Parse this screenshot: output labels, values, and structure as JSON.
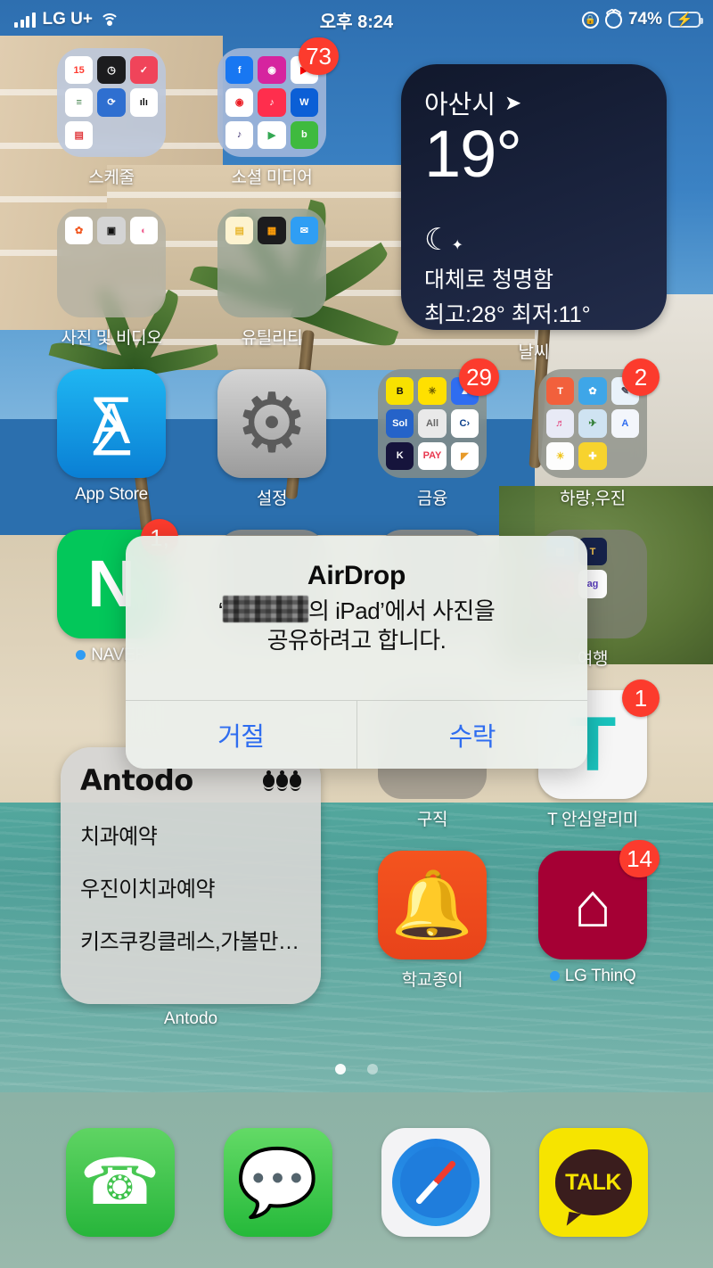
{
  "status_bar": {
    "carrier": "LG U+",
    "time": "오후 8:24",
    "battery_percent": "74%",
    "icons": [
      "signal-bars-icon",
      "wifi-icon",
      "rotation-lock-icon",
      "alarm-icon",
      "battery-charging-icon"
    ]
  },
  "weather_widget": {
    "city": "아산시",
    "temperature": "19°",
    "condition": "대체로 청명함",
    "high_low": "최고:28° 최저:11°",
    "label": "날씨",
    "location_icon": "location-arrow-icon",
    "condition_icon": "moon-stars-icon"
  },
  "antodo_widget": {
    "title": "Antodo",
    "items": [
      "치과예약",
      "우진이치과예약",
      "키즈쿠킹클레스,가볼만…"
    ],
    "label": "Antodo",
    "icon": "ants-icon"
  },
  "apps": [
    {
      "label": "스케줄",
      "type": "folder",
      "badge": "",
      "new": false,
      "folder_bg": "#b9c8e2",
      "minis": [
        {
          "name": "calendar-app",
          "bg": "#ffffff",
          "fg": "#ff3b30",
          "text": "15"
        },
        {
          "name": "clock-app",
          "bg": "#1c1c1e",
          "fg": "#ffffff",
          "text": "◷"
        },
        {
          "name": "todo-app",
          "bg": "#f0445a",
          "fg": "#ffffff",
          "text": "✓"
        },
        {
          "name": "planner-app",
          "bg": "#ffffff",
          "fg": "#3a7d44",
          "text": "≡"
        },
        {
          "name": "sync-app",
          "bg": "#2f6fd0",
          "fg": "#ffffff",
          "text": "⟳"
        },
        {
          "name": "habit-app",
          "bg": "#ffffff",
          "fg": "#111111",
          "text": "ılı"
        },
        {
          "name": "schedule-app",
          "bg": "#ffffff",
          "fg": "#e0383c",
          "text": "▤"
        },
        {
          "name": "empty-slot",
          "bg": "transparent",
          "fg": "",
          "text": ""
        },
        {
          "name": "empty-slot",
          "bg": "transparent",
          "fg": "",
          "text": ""
        }
      ]
    },
    {
      "label": "소셜 미디어",
      "type": "folder",
      "badge": "73",
      "new": false,
      "folder_bg": "#aebede",
      "minis": [
        {
          "name": "facebook-app",
          "bg": "#1877f2",
          "fg": "#ffffff",
          "text": "f"
        },
        {
          "name": "instagram-app",
          "bg": "#d6249f",
          "fg": "#ffffff",
          "text": "◉"
        },
        {
          "name": "youtube-app",
          "bg": "#ffffff",
          "fg": "#ff0000",
          "text": "▶"
        },
        {
          "name": "afreeca-app",
          "bg": "#ffffff",
          "fg": "#eb1c24",
          "text": "◉"
        },
        {
          "name": "tiktok-app",
          "bg": "#ff2e4d",
          "fg": "#ffffff",
          "text": "♪"
        },
        {
          "name": "wadiz-app",
          "bg": "#0b5fd6",
          "fg": "#ffffff",
          "text": "W"
        },
        {
          "name": "band-app",
          "bg": "#ffffff",
          "fg": "#3a2c6e",
          "text": "♪"
        },
        {
          "name": "playstore-app",
          "bg": "#ffffff",
          "fg": "#34a853",
          "text": "▶"
        },
        {
          "name": "blog-app",
          "bg": "#3fba3f",
          "fg": "#ffffff",
          "text": "b"
        }
      ]
    },
    {
      "label": "사진 및 비디오",
      "type": "folder",
      "badge": "",
      "new": false,
      "folder_bg": "#b4b1a4",
      "minis": [
        {
          "name": "photos-app",
          "bg": "#ffffff",
          "fg": "#f15a24",
          "text": "✿"
        },
        {
          "name": "camera-app",
          "bg": "#d4d4d4",
          "fg": "#111111",
          "text": "▣"
        },
        {
          "name": "filter-app",
          "bg": "#ffffff",
          "fg": "#f06292",
          "text": "◐"
        },
        {
          "name": "empty-slot",
          "bg": "transparent",
          "fg": "",
          "text": ""
        },
        {
          "name": "empty-slot",
          "bg": "transparent",
          "fg": "",
          "text": ""
        },
        {
          "name": "empty-slot",
          "bg": "transparent",
          "fg": "",
          "text": ""
        },
        {
          "name": "empty-slot",
          "bg": "transparent",
          "fg": "",
          "text": ""
        },
        {
          "name": "empty-slot",
          "bg": "transparent",
          "fg": "",
          "text": ""
        },
        {
          "name": "empty-slot",
          "bg": "transparent",
          "fg": "",
          "text": ""
        }
      ]
    },
    {
      "label": "유틸리티",
      "type": "folder",
      "badge": "",
      "new": false,
      "folder_bg": "#9aa597",
      "minis": [
        {
          "name": "notes-app",
          "bg": "#fdf3d0",
          "fg": "#e8b62c",
          "text": "▤"
        },
        {
          "name": "calculator-app",
          "bg": "#1c1c1e",
          "fg": "#ff9f0a",
          "text": "▦"
        },
        {
          "name": "mail-app",
          "bg": "#2f9ef4",
          "fg": "#ffffff",
          "text": "✉"
        },
        {
          "name": "empty-slot",
          "bg": "transparent",
          "fg": "",
          "text": ""
        },
        {
          "name": "empty-slot",
          "bg": "transparent",
          "fg": "",
          "text": ""
        },
        {
          "name": "empty-slot",
          "bg": "transparent",
          "fg": "",
          "text": ""
        },
        {
          "name": "empty-slot",
          "bg": "transparent",
          "fg": "",
          "text": ""
        },
        {
          "name": "empty-slot",
          "bg": "transparent",
          "fg": "",
          "text": ""
        },
        {
          "name": "empty-slot",
          "bg": "transparent",
          "fg": "",
          "text": ""
        }
      ]
    },
    {
      "label": "App Store",
      "type": "app",
      "badge": "",
      "new": false,
      "icon": "app-store-icon"
    },
    {
      "label": "설정",
      "type": "app",
      "badge": "",
      "new": false,
      "icon": "settings-gear-icon"
    },
    {
      "label": "금융",
      "type": "folder",
      "badge": "29",
      "new": false,
      "folder_bg": "#8a8e86",
      "minis": [
        {
          "name": "kakaobank-app",
          "bg": "#f8e100",
          "fg": "#111111",
          "text": "B"
        },
        {
          "name": "kbbank-app",
          "bg": "#ffe000",
          "fg": "#6b5b00",
          "text": "✳"
        },
        {
          "name": "toss-app",
          "bg": "#2f6df0",
          "fg": "#ffffff",
          "text": "▲"
        },
        {
          "name": "shinhan-app",
          "bg": "#2563c9",
          "fg": "#ffffff",
          "text": "Sol"
        },
        {
          "name": "nhbank-app",
          "bg": "#e9e9e9",
          "fg": "#666666",
          "text": "All"
        },
        {
          "name": "citi-app",
          "bg": "#ffffff",
          "fg": "#0b3f8c",
          "text": "C›"
        },
        {
          "name": "kbank-app",
          "bg": "#16143c",
          "fg": "#ffffff",
          "text": "K"
        },
        {
          "name": "payco-app",
          "bg": "#ffffff",
          "fg": "#e8384f",
          "text": "PAY"
        },
        {
          "name": "ibk-app",
          "bg": "#ffffff",
          "fg": "#e79a2a",
          "text": "◤"
        }
      ]
    },
    {
      "label": "하랑,우진",
      "type": "folder",
      "badge": "2",
      "new": false,
      "folder_bg": "#8d9189",
      "minis": [
        {
          "name": "toktok-kids-app",
          "bg": "#f2603c",
          "fg": "#ffffff",
          "text": "T"
        },
        {
          "name": "kids-game-app",
          "bg": "#3ea6e8",
          "fg": "#ffffff",
          "text": "✿"
        },
        {
          "name": "study-app",
          "bg": "#e9f2fa",
          "fg": "#445",
          "text": "✎"
        },
        {
          "name": "kids-song-app",
          "bg": "#e8eaf6",
          "fg": "#e2407a",
          "text": "♬"
        },
        {
          "name": "outdoor-app",
          "bg": "#cfe3f2",
          "fg": "#2f7d32",
          "text": "✈"
        },
        {
          "name": "english-app",
          "bg": "#f3f6fb",
          "fg": "#2f6df0",
          "text": "A"
        },
        {
          "name": "dental-kids-app",
          "bg": "#fdfdfd",
          "fg": "#f0c419",
          "text": "☀"
        },
        {
          "name": "health-app",
          "bg": "#f7d32e",
          "fg": "#ffffff",
          "text": "✚"
        },
        {
          "name": "empty-slot",
          "bg": "transparent",
          "fg": "",
          "text": ""
        }
      ]
    },
    {
      "label": "NAVER",
      "type": "app",
      "badge": "1,",
      "new": true,
      "icon": "naver-icon"
    },
    {
      "label": "",
      "type": "app",
      "badge": "",
      "new": false,
      "icon": "hidden-icon"
    },
    {
      "label": "",
      "type": "app",
      "badge": "",
      "new": false,
      "icon": "hidden-icon"
    },
    {
      "label": "여행",
      "type": "folder",
      "badge": "",
      "new": false,
      "folder_bg": "#7d7f72",
      "minis": [
        {
          "name": "subway-app",
          "bg": "#2f9ef4",
          "fg": "#ffffff",
          "text": "▤"
        },
        {
          "name": "korail-app",
          "bg": "#16224a",
          "fg": "#f2c14e",
          "text": "T"
        },
        {
          "name": "empty-slot",
          "bg": "transparent",
          "fg": "",
          "text": ""
        },
        {
          "name": "airbnb-app",
          "bg": "#ff385c",
          "fg": "#ffffff",
          "text": "⌂"
        },
        {
          "name": "agoda-app",
          "bg": "#ffffff",
          "fg": "#5b3fbf",
          "text": "ag"
        },
        {
          "name": "empty-slot",
          "bg": "transparent",
          "fg": "",
          "text": ""
        },
        {
          "name": "empty-slot",
          "bg": "transparent",
          "fg": "",
          "text": ""
        },
        {
          "name": "empty-slot",
          "bg": "transparent",
          "fg": "",
          "text": ""
        },
        {
          "name": "empty-slot",
          "bg": "transparent",
          "fg": "",
          "text": ""
        }
      ]
    },
    {
      "label": "구직",
      "type": "folder",
      "badge": "",
      "new": false,
      "folder_bg": "#9b958b",
      "minis": [
        {
          "name": "empty-slot",
          "bg": "transparent",
          "fg": "",
          "text": ""
        },
        {
          "name": "empty-slot",
          "bg": "transparent",
          "fg": "",
          "text": ""
        },
        {
          "name": "empty-slot",
          "bg": "transparent",
          "fg": "",
          "text": ""
        },
        {
          "name": "empty-slot",
          "bg": "transparent",
          "fg": "",
          "text": ""
        },
        {
          "name": "empty-slot",
          "bg": "transparent",
          "fg": "",
          "text": ""
        },
        {
          "name": "empty-slot",
          "bg": "transparent",
          "fg": "",
          "text": ""
        },
        {
          "name": "empty-slot",
          "bg": "transparent",
          "fg": "",
          "text": ""
        },
        {
          "name": "empty-slot",
          "bg": "transparent",
          "fg": "",
          "text": ""
        },
        {
          "name": "empty-slot",
          "bg": "transparent",
          "fg": "",
          "text": ""
        }
      ]
    },
    {
      "label": "T 안심알리미",
      "type": "app",
      "badge": "1",
      "new": false,
      "icon": "t-safety-icon"
    },
    {
      "label": "학교종이",
      "type": "app",
      "badge": "",
      "new": false,
      "icon": "school-bell-icon"
    },
    {
      "label": "LG ThinQ",
      "type": "app",
      "badge": "14",
      "new": true,
      "icon": "lg-thinq-house-icon"
    }
  ],
  "page_dots": {
    "count": 2,
    "active_index": 0
  },
  "dock": [
    {
      "label": "Phone",
      "icon": "phone-icon"
    },
    {
      "label": "Messages",
      "icon": "messages-icon"
    },
    {
      "label": "Safari",
      "icon": "safari-compass-icon"
    },
    {
      "label": "KakaoTalk",
      "icon": "kakaotalk-icon",
      "text": "TALK"
    }
  ],
  "airdrop_dialog": {
    "title": "AirDrop",
    "message_prefix": "‘",
    "message_redacted": "[이름]",
    "message_suffix": "의 iPad’에서 사진을",
    "message_line2": "공유하려고 합니다.",
    "decline_label": "거절",
    "accept_label": "수락",
    "accent_color": "#2f6df0"
  }
}
